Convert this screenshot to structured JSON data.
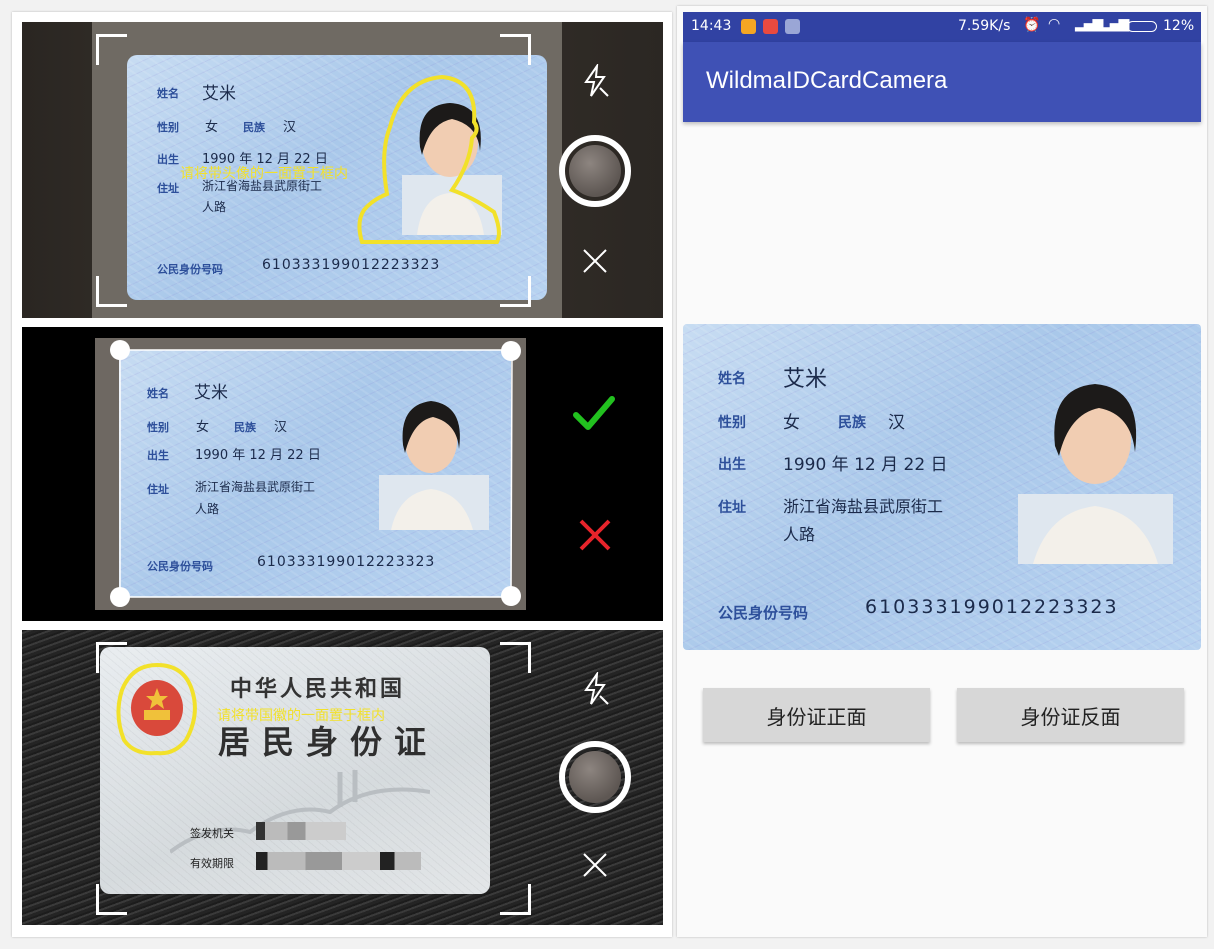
{
  "panel1_front_capture": {
    "card": {
      "name_label": "姓名",
      "name": "艾米",
      "sex_label": "性别",
      "sex": "女",
      "ethnicity_label": "民族",
      "ethnicity": "汉",
      "birth_label": "出生",
      "birth": "1990 年 12 月 22 日",
      "address_label": "住址",
      "address_line1": "浙江省海盐县武原街工",
      "address_line2": "人路",
      "id_label": "公民身份号码",
      "id_number": "610333199012223323"
    },
    "hint": "请将带头像的一面置于框内",
    "flash_icon": "flash-off-icon",
    "shutter_icon": "shutter-button",
    "close_icon": "close-icon"
  },
  "panel2_crop": {
    "card": {
      "name_label": "姓名",
      "name": "艾米",
      "sex_label": "性别",
      "sex": "女",
      "ethnicity_label": "民族",
      "ethnicity": "汉",
      "birth_label": "出生",
      "birth": "1990 年 12 月 22 日",
      "address_label": "住址",
      "address_line1": "浙江省海盐县武原街工",
      "address_line2": "人路",
      "id_label": "公民身份号码",
      "id_number": "610333199012223323"
    },
    "confirm_icon": "check-icon",
    "cancel_icon": "close-icon",
    "confirm_color": "#22c11f",
    "cancel_color": "#e8242b"
  },
  "panel3_back_capture": {
    "card": {
      "country": "中华人民共和国",
      "title": "居民身份证",
      "authority_label": "签发机关",
      "validity_label": "有效期限"
    },
    "hint": "请将带国徽的一面置于框内",
    "flash_icon": "flash-off-icon",
    "shutter_icon": "shutter-button",
    "close_icon": "close-icon"
  },
  "android": {
    "status": {
      "time": "14:43",
      "speed": "7.59K/s",
      "battery": "12%"
    },
    "app_title": "WildmaIDCardCamera",
    "result_card": {
      "name_label": "姓名",
      "name": "艾米",
      "sex_label": "性别",
      "sex": "女",
      "ethnicity_label": "民族",
      "ethnicity": "汉",
      "birth_label": "出生",
      "birth": "1990 年 12 月 22 日",
      "address_label": "住址",
      "address_line1": "浙江省海盐县武原街工",
      "address_line2": "人路",
      "id_label": "公民身份号码",
      "id_number": "610333199012223323"
    },
    "buttons": {
      "front": "身份证正面",
      "back": "身份证反面"
    },
    "colors": {
      "primary": "#3f51b5",
      "primary_dark": "#3142a3",
      "accent_yellow": "#f2e12a"
    }
  }
}
